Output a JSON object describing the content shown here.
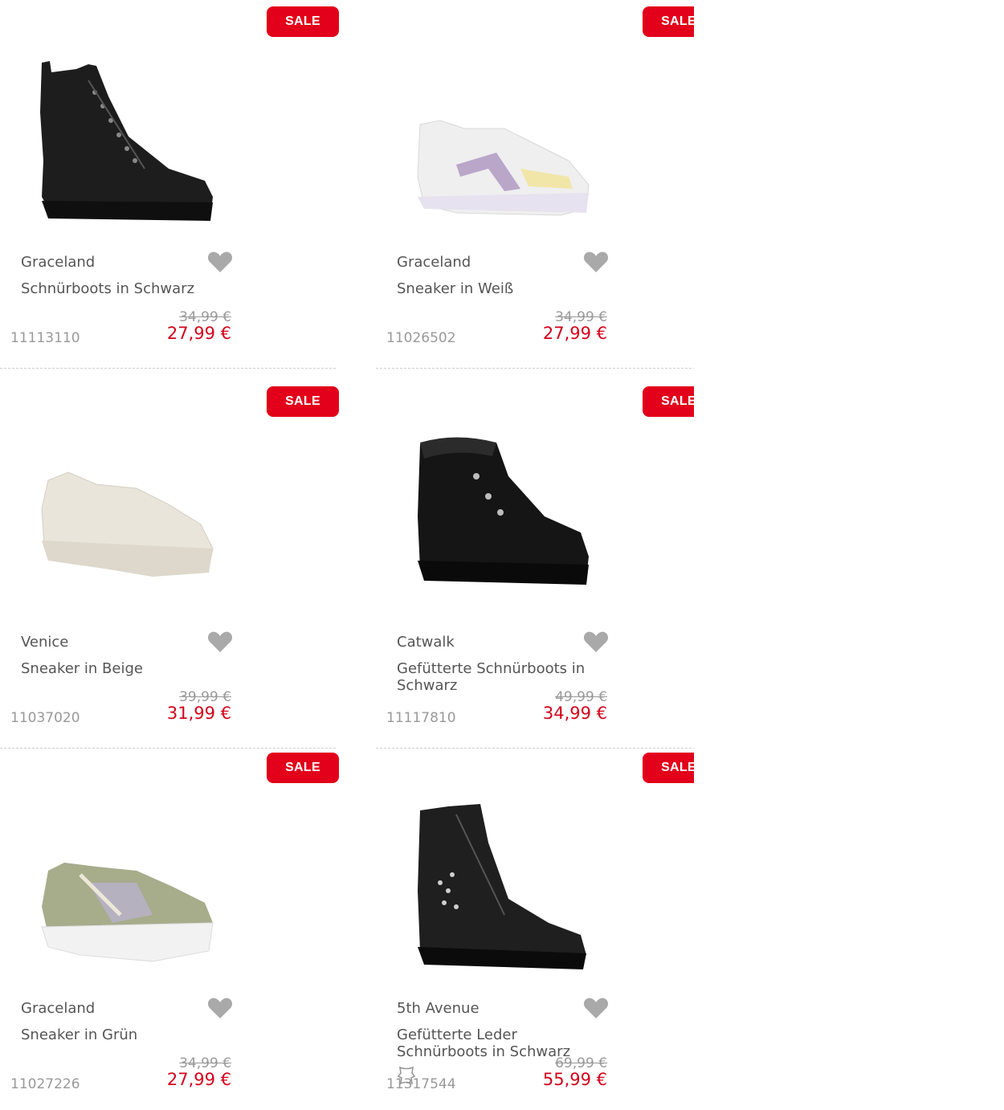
{
  "sale_label": "SALE",
  "colors": {
    "accent": "#e2001a",
    "price": "#d3001a",
    "muted": "#999999"
  },
  "products": [
    {
      "brand": "Graceland",
      "name": "Schnürboots in Schwarz",
      "old_price": "34,99 €",
      "price": "27,99 €",
      "sku": "11113110",
      "image": "black-lace-up-boot"
    },
    {
      "brand": "Graceland",
      "name": "Sneaker in Weiß",
      "old_price": "34,99 €",
      "price": "27,99 €",
      "sku": "11026502",
      "image": "white-sneaker"
    },
    {
      "brand": "Venice",
      "name": "Sneaker in Beige",
      "old_price": "39,99 €",
      "price": "31,99 €",
      "sku": "11037020",
      "image": "beige-chunky-sneaker"
    },
    {
      "brand": "Catwalk",
      "name": "Gefütterte Schnürboots in Schwarz",
      "old_price": "49,99 €",
      "price": "34,99 €",
      "sku": "11117810",
      "image": "black-lined-ankle-boot"
    },
    {
      "brand": "Graceland",
      "name": "Sneaker in Grün",
      "old_price": "34,99 €",
      "price": "27,99 €",
      "sku": "11027226",
      "image": "green-sneaker"
    },
    {
      "brand": "5th Avenue",
      "name": "Gefütterte Leder Schnürboots in Schwarz",
      "old_price": "69,99 €",
      "price": "55,99 €",
      "sku": "11317544",
      "image": "black-leather-boot"
    }
  ]
}
